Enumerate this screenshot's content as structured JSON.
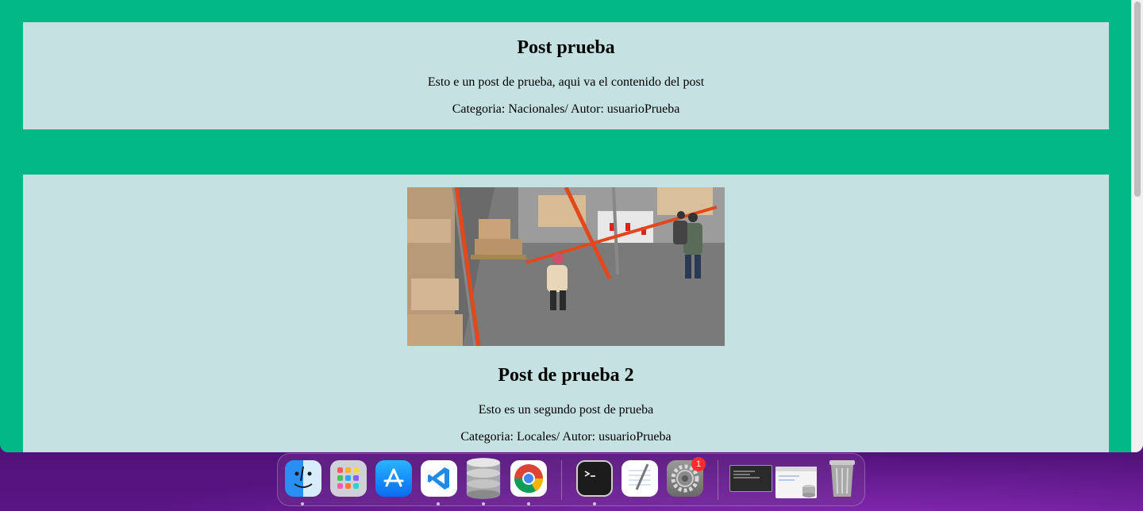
{
  "posts": [
    {
      "title": "Post prueba",
      "body": "Esto e un post de prueba, aqui va el contenido del post",
      "meta": "Categoria: Nacionales/ Autor: usuarioPrueba"
    },
    {
      "title": "Post de prueba 2",
      "body": "Esto es un segundo post de prueba",
      "meta": "Categoria: Locales/ Autor: usuarioPrueba",
      "image": "warehouse-photo"
    }
  ],
  "dock": {
    "apps": [
      {
        "name": "finder-icon",
        "running": true
      },
      {
        "name": "launchpad-icon",
        "running": false
      },
      {
        "name": "app-store-icon",
        "running": false
      },
      {
        "name": "vscode-icon",
        "running": true
      },
      {
        "name": "database-icon",
        "running": true
      },
      {
        "name": "chrome-icon",
        "running": true
      },
      {
        "name": "terminal-icon",
        "running": true
      },
      {
        "name": "textedit-icon",
        "running": false
      },
      {
        "name": "system-preferences-icon",
        "running": false,
        "badge": "1"
      },
      {
        "name": "recent-window-terminal-icon",
        "running": false
      },
      {
        "name": "recent-window-db-icon",
        "running": false
      },
      {
        "name": "trash-icon",
        "running": false
      }
    ]
  },
  "colors": {
    "page_background": "#00b886",
    "card_background": "#c5e1e1",
    "badge": "#ff2d2d"
  }
}
